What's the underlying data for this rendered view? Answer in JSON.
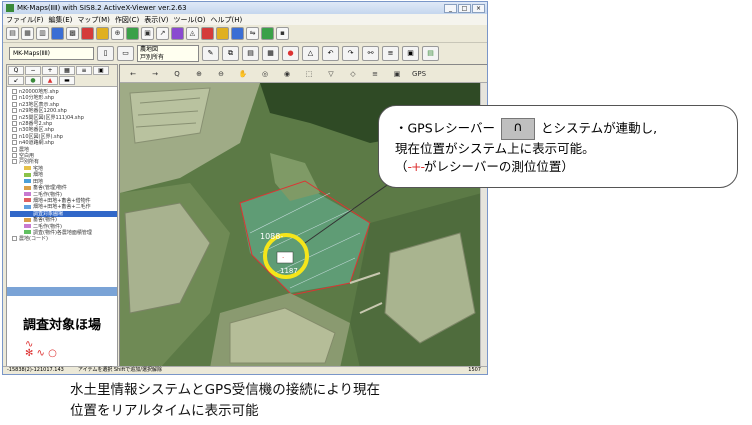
{
  "window": {
    "title": "MK-Maps(",
    "title_full": "MK-Maps(ⅡⅡ) with SIS8.2 ActiveX-Viewer ver.2.63"
  },
  "menubar": [
    "ファイル(F)",
    "編集(E)",
    "マップ(M)",
    "作図(C)",
    "表示(V)",
    "ツール(O)",
    "ヘルプ(H)"
  ],
  "toolbar2": {
    "map_combo": "MK-Maps(ⅡⅡ)",
    "layer_box": [
      "農地図",
      "戸別所有"
    ]
  },
  "tree": [
    {
      "label": "n20000地形.shp",
      "kind": "layer"
    },
    {
      "label": "n10分地形.shp",
      "kind": "layer"
    },
    {
      "label": "n23地区表示.shp",
      "kind": "layer"
    },
    {
      "label": "n29地番区1200.shp",
      "kind": "layer"
    },
    {
      "label": "n25関区図(区界111)04.shp",
      "kind": "layer"
    },
    {
      "label": "n28番号2.shp",
      "kind": "layer"
    },
    {
      "label": "n30地番区.shp",
      "kind": "layer"
    },
    {
      "label": "n10区図(区界).shp",
      "kind": "layer"
    },
    {
      "label": "n40道路網.shp",
      "kind": "layer"
    },
    {
      "label": "農地",
      "kind": "group"
    },
    {
      "label": "空白用",
      "kind": "group"
    },
    {
      "label": "戸別所有",
      "kind": "group"
    },
    {
      "label": "宅地",
      "kind": "item",
      "color": "#e6c24a"
    },
    {
      "label": "畑地",
      "kind": "item",
      "color": "#8bc34a"
    },
    {
      "label": "田地",
      "kind": "item",
      "color": "#4a9fd8"
    },
    {
      "label": "畜舎(管理)物件",
      "kind": "item",
      "color": "#d8a04a"
    },
    {
      "label": "二毛作(物件)",
      "kind": "item",
      "color": "#c87ad0"
    },
    {
      "label": "畑地+田地+畜舎+借物件",
      "kind": "item",
      "color": "#e06060"
    },
    {
      "label": "畑地+田地+畜舎+二毛作",
      "kind": "item",
      "color": "#60a0e0"
    },
    {
      "label": "調査対象圃場",
      "kind": "item",
      "color": "#3167c8",
      "selected": true
    },
    {
      "label": "畜舎(物件)",
      "kind": "item",
      "color": "#d8a04a"
    },
    {
      "label": "二毛作(物件)",
      "kind": "item",
      "color": "#c87ad0"
    },
    {
      "label": "調査(物件)各農地面積管理",
      "kind": "item",
      "color": "#60c060"
    },
    {
      "label": "農地(コード)",
      "kind": "group"
    }
  ],
  "legend": {
    "title": "調査対象ほ場"
  },
  "map_tools": [
    "←",
    "→",
    "Q",
    "⊕",
    "⊖",
    "✋",
    "◎",
    "◉",
    "⬚",
    "▽",
    "◇",
    "≡",
    "▣",
    "GPS"
  ],
  "map_labels": {
    "parcel_top": "1088-",
    "parcel_bottom": "1187"
  },
  "statusbar": {
    "coords": "-15838(2)-121017.143",
    "hint": "アイテムを選択 Shiftで追加/選択解除",
    "right": "1507"
  },
  "callout": {
    "line1_pre": "・GPSレシーバー",
    "line1_post": "とシステムが連動し,",
    "line2": "現在位置がシステム上に表示可能。",
    "line3_pre": "（",
    "line3_post": "がレシーバーの測位位置）",
    "marker_symbol": "-+-"
  },
  "caption": {
    "line1": "水土里情報システムとGPS受信機の接続により現在",
    "line2": "位置をリアルタイムに表示可能"
  }
}
